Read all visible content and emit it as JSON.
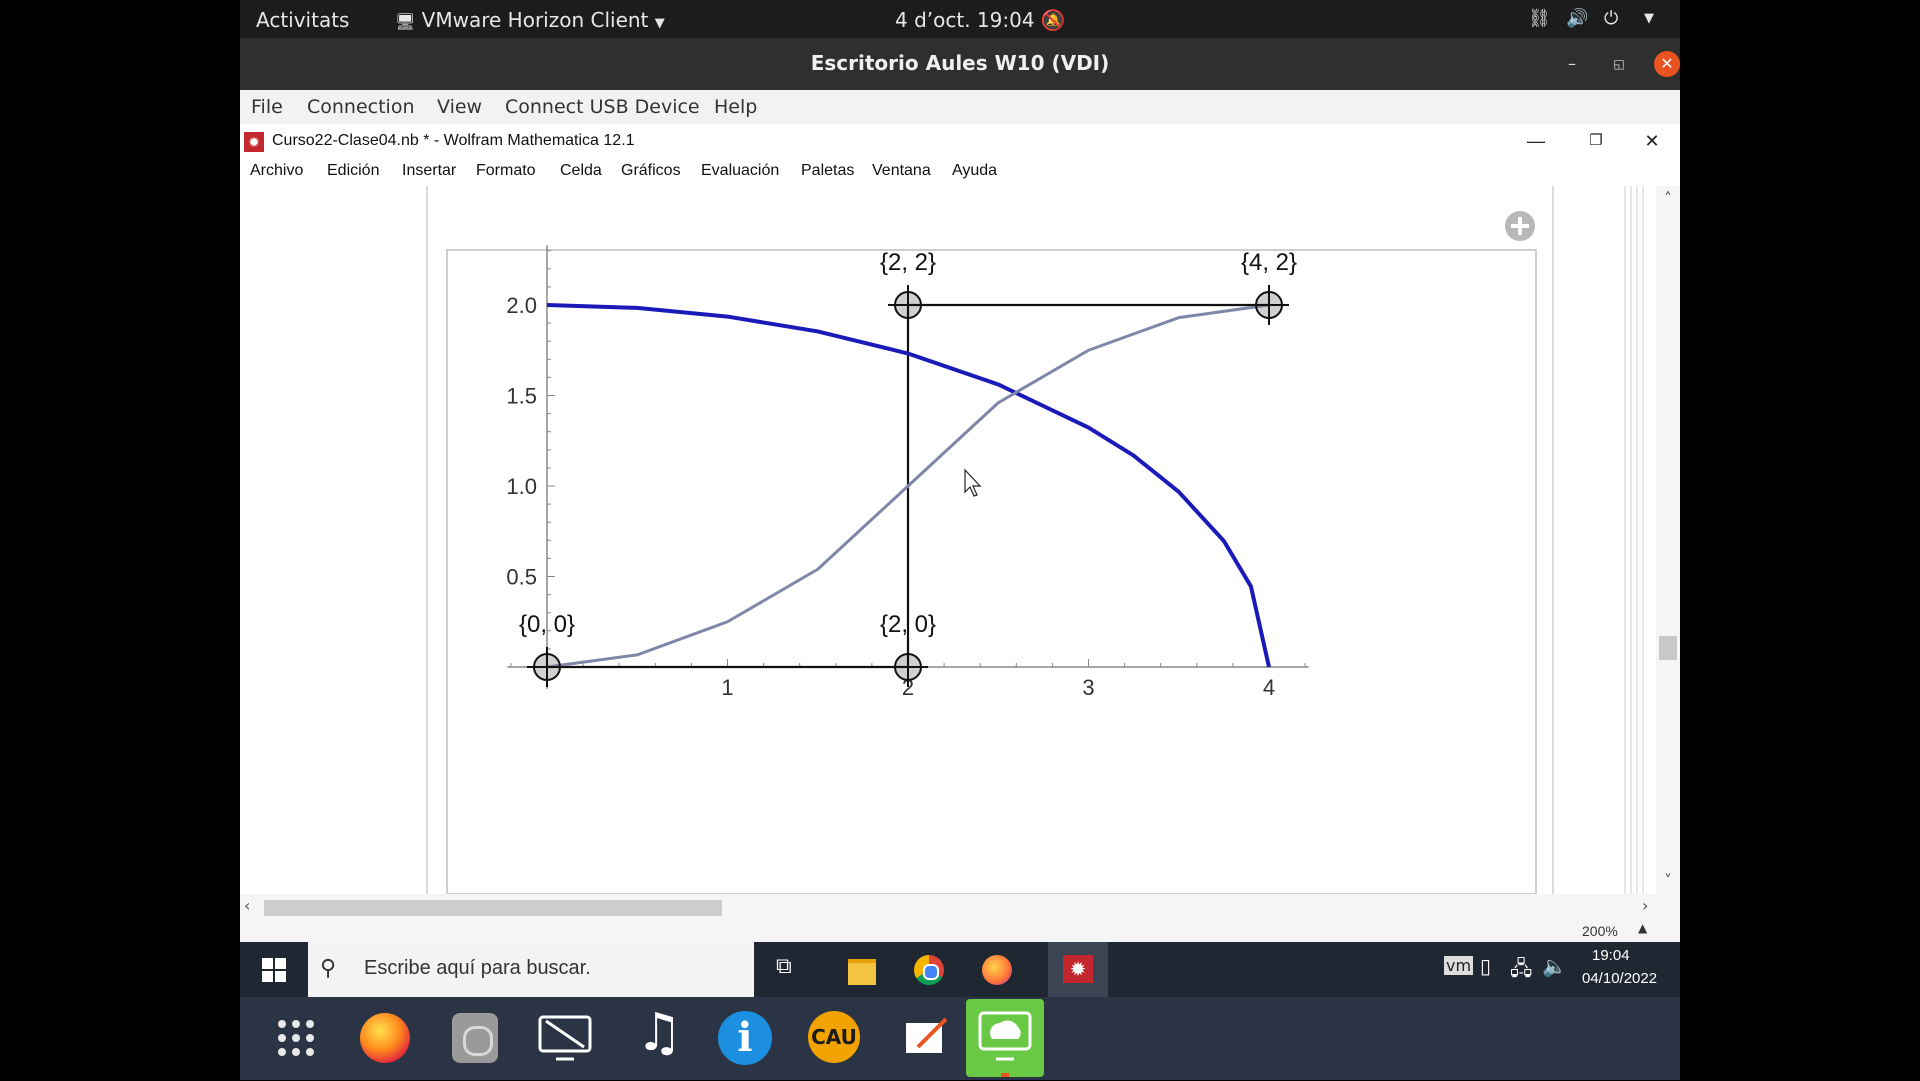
{
  "gnome": {
    "activities": "Activitats",
    "app_menu": "VMware Horizon Client",
    "clock": "4 d’oct.  19:04"
  },
  "horizon": {
    "window_title": "Escritorio Aules W10 (VDI)",
    "menu": [
      "File",
      "Connection",
      "View",
      "Connect USB Device",
      "Help"
    ]
  },
  "mathematica": {
    "title": "Curso22-Clase04.nb * - Wolfram Mathematica 12.1",
    "menu": [
      "Archivo",
      "Edición",
      "Insertar",
      "Formato",
      "Celda",
      "Gráficos",
      "Evaluación",
      "Paletas",
      "Ventana",
      "Ayuda"
    ],
    "zoom": "200%"
  },
  "chart_data": {
    "type": "line",
    "x_ticks": [
      "1",
      "2",
      "3",
      "4"
    ],
    "y_ticks": [
      "0.5",
      "1.0",
      "1.5",
      "2.0"
    ],
    "xlim": [
      0,
      4
    ],
    "ylim": [
      0,
      2
    ],
    "control_points": [
      {
        "label": "{0, 0}",
        "x": 0,
        "y": 0
      },
      {
        "label": "{2, 0}",
        "x": 2,
        "y": 0
      },
      {
        "label": "{2, 2}",
        "x": 2,
        "y": 2
      },
      {
        "label": "{4, 2}",
        "x": 4,
        "y": 2
      }
    ],
    "series": [
      {
        "style": "blue-thick",
        "color": "#1a1ab8",
        "x": [
          0,
          0.5,
          1,
          1.5,
          2,
          2.5,
          3,
          3.25,
          3.5,
          3.75,
          3.9,
          4
        ],
        "y": [
          2,
          1.984,
          1.936,
          1.854,
          1.732,
          1.561,
          1.323,
          1.168,
          0.968,
          0.696,
          0.445,
          0
        ]
      },
      {
        "style": "gray-bezier",
        "color": "#7f86a8",
        "x": [
          0,
          0.5,
          1,
          1.5,
          2,
          2.5,
          3,
          3.5,
          4
        ],
        "y": [
          0,
          0.067,
          0.25,
          0.54,
          1,
          1.46,
          1.75,
          1.93,
          2
        ]
      }
    ]
  },
  "taskbar": {
    "search_placeholder": "Escribe aquí para buscar.",
    "time": "19:04",
    "date": "04/10/2022"
  },
  "colors": {
    "mathematica_red": "#c1272d",
    "curve_blue": "#1a1ab8",
    "bezier_gray": "#7f86a8"
  }
}
